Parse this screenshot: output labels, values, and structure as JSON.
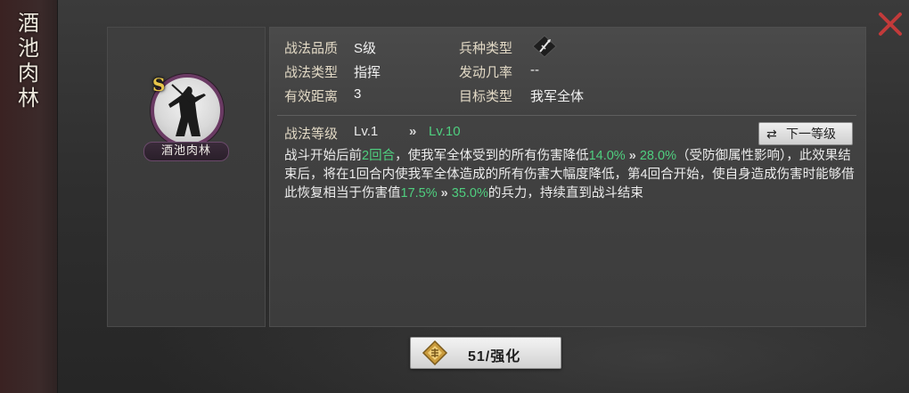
{
  "tactic_name_vertical": [
    "酒",
    "池",
    "肉",
    "林"
  ],
  "tactic_name": "酒池肉林",
  "grade_letter": "S",
  "info": {
    "quality_label": "战法品质",
    "quality_value": "S级",
    "troop_type_label": "兵种类型",
    "troop_type_icon": "spear-troop-icon",
    "tactic_type_label": "战法类型",
    "tactic_type_value": "指挥",
    "trigger_rate_label": "发动几率",
    "trigger_rate_value": "--",
    "range_label": "有效距离",
    "range_value": "3",
    "target_label": "目标类型",
    "target_value": "我军全体"
  },
  "level": {
    "label": "战法等级",
    "current": "Lv.1",
    "arrow": "»",
    "next": "Lv.10",
    "next_button_label": "下一等级"
  },
  "description": {
    "p1": "战斗开始后前",
    "rounds": "2回合",
    "p2": "，使我军全体受到的所有伤害降低",
    "v1_cur": "14.0%",
    "arrow": "»",
    "v1_next": "28.0%",
    "p3": "（受防御属性影响），此效果结束后，将在1回合内使我军全体造成的所有伤害大幅度降低，第4回合开始，使自身造成伤害时能够借此恢复相当于伤害值",
    "v2_cur": "17.5%",
    "v2_next": "35.0%",
    "p4": "的兵力，持续直到战斗结束"
  },
  "upgrade_button": {
    "label": "51/强化",
    "icon": "upgrade-gem-icon"
  },
  "colors": {
    "accent_green": "#4fcf7f",
    "close_red": "#c23a3a",
    "grade_gold": "#e7c44a"
  }
}
